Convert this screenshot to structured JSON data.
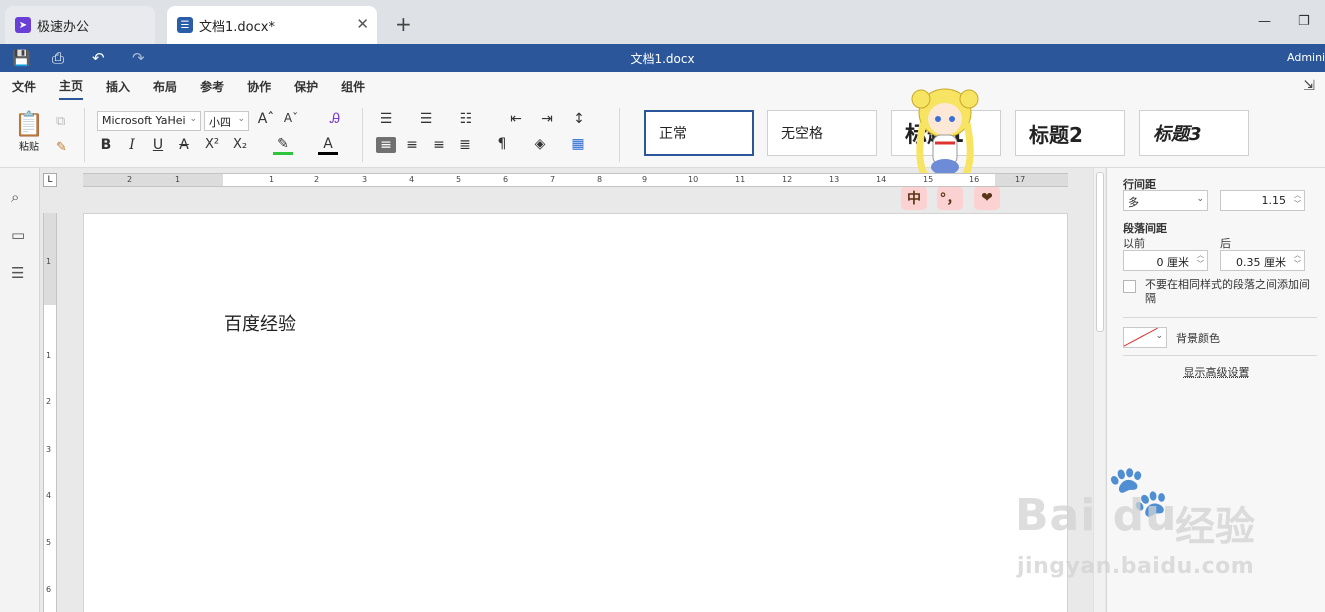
{
  "tabs": [
    {
      "label": "极速办公"
    },
    {
      "label": "文档1.docx*"
    }
  ],
  "titlebar": {
    "title": "文档1.docx",
    "user": "Adminis"
  },
  "menu": [
    "文件",
    "主页",
    "插入",
    "布局",
    "参考",
    "协作",
    "保护",
    "组件"
  ],
  "toolbar": {
    "paste_label": "粘贴",
    "font_name": "Microsoft YaHei",
    "font_size": "小四",
    "grow_font": "Aˆ",
    "shrink_font": "Aˇ",
    "bold": "B",
    "italic": "I",
    "underline": "U",
    "strike": "A",
    "superscript": "X²",
    "subscript": "X₂",
    "font_color": "A"
  },
  "styles": [
    "正常",
    "无空格",
    "标题1",
    "标题2",
    "标题3"
  ],
  "ime": {
    "chinese": "中",
    "punct": "°，",
    "heart": "❤"
  },
  "ruler_numbers": [
    "2",
    "1",
    "1",
    "2",
    "3",
    "4",
    "5",
    "6",
    "7",
    "8",
    "9",
    "10",
    "11",
    "12",
    "13",
    "14",
    "15",
    "16",
    "17"
  ],
  "vruler_numbers": [
    "1",
    "1",
    "2",
    "3",
    "4",
    "5",
    "6"
  ],
  "document": {
    "text": "百度经验"
  },
  "panel": {
    "line_spacing_label": "行间距",
    "line_spacing_mode": "多",
    "line_spacing_value": "1.15",
    "para_spacing_label": "段落间距",
    "before_label": "以前",
    "after_label": "后",
    "before_value": "0 厘米",
    "after_value": "0.35 厘米",
    "no_space_same_style": "不要在相同样式的段落之间添加间隔",
    "bg_color_label": "背景颜色",
    "advanced_link": "显示高级设置"
  },
  "watermark": {
    "logo": "Bai du",
    "cn": "经验",
    "url": "jingyan.baidu.com"
  },
  "colors": {
    "titlebar": "#2b579a",
    "accent": "#2b579a",
    "font_color_bar": "#000000",
    "highlight_bar": "#2ec43b",
    "ime_bg": "#fbd1d1"
  }
}
